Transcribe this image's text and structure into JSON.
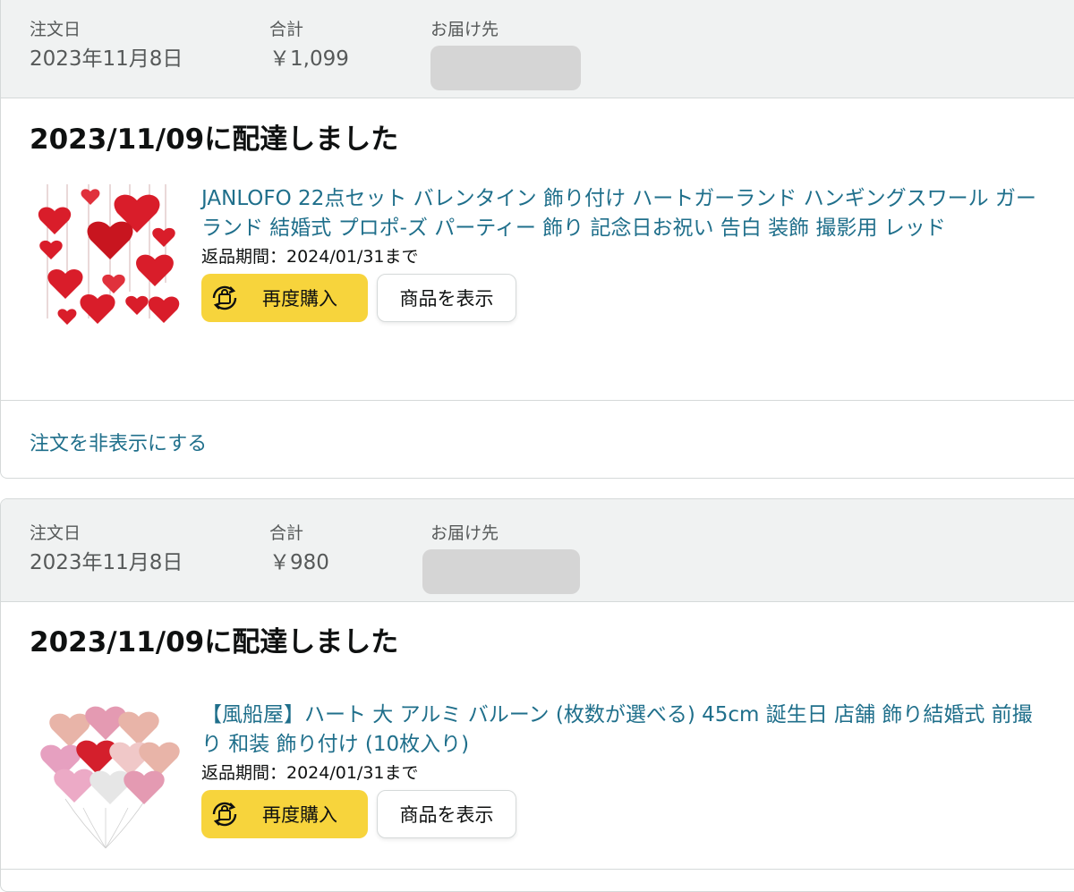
{
  "orders": [
    {
      "header": {
        "date_label": "注文日",
        "date_value": "2023年11月8日",
        "total_label": "合計",
        "total_value": "￥1,099",
        "ship_label": "お届け先"
      },
      "delivery_status": "2023/11/09に配達しました",
      "item": {
        "title": "JANLOFO 22点セット バレンタイン 飾り付け ハートガーランド ハンギングスワール ガーランド 結婚式 プロポ-ズ パーティー 飾り 記念日お祝い 告白 装飾 撮影用 レッド",
        "return_window": "返品期間：2024/01/31まで",
        "rebuy_label": "再度購入",
        "view_label": "商品を表示",
        "thumbnail_icon": "heart-garland-image"
      },
      "hide_order_label": "注文を非表示にする"
    },
    {
      "header": {
        "date_label": "注文日",
        "date_value": "2023年11月8日",
        "total_label": "合計",
        "total_value": "￥980",
        "ship_label": "お届け先"
      },
      "delivery_status": "2023/11/09に配達しました",
      "item": {
        "title": "【風船屋】ハート 大 アルミ バルーン (枚数が選べる) 45cm 誕生日 店舗 飾り結婚式 前撮り 和装 飾り付け (10枚入り)",
        "return_window": "返品期間：2024/01/31まで",
        "rebuy_label": "再度購入",
        "view_label": "商品を表示",
        "thumbnail_icon": "heart-balloons-image"
      }
    }
  ],
  "colors": {
    "header_bg": "#f0f2f2",
    "link": "#1f6f8b",
    "rebuy_button": "#f7d43c",
    "border": "#d5d9d9"
  }
}
